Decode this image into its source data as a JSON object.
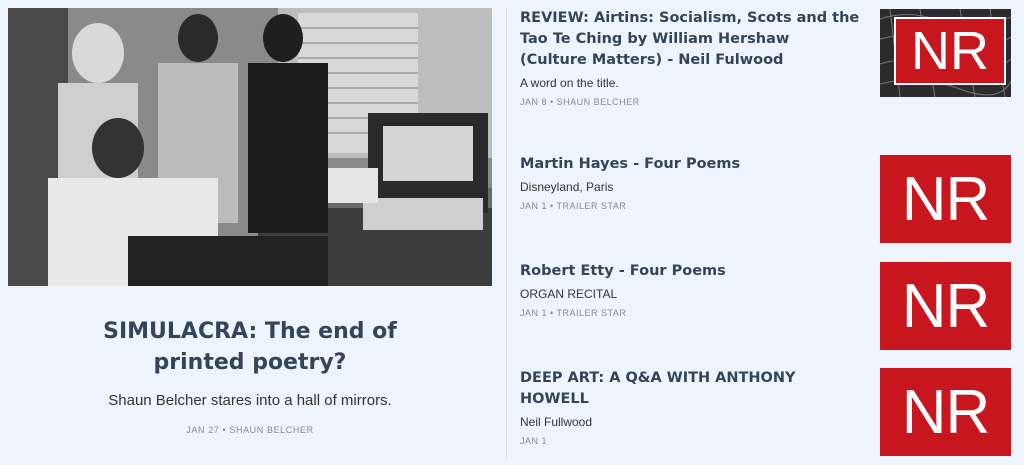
{
  "feature": {
    "title": "SIMULACRA: The end of printed poetry?",
    "subtitle": "Shaun Belcher stares into a hall of mirrors.",
    "meta": "JAN 27 • SHAUN BELCHER",
    "image_icon": "photo-people-at-computer"
  },
  "articles": [
    {
      "title": "REVIEW: Airtins: Socialism, Scots and the Tao Te Ching by William Hershaw (Culture Matters) - Neil Fulwood",
      "subtitle": "A word on the title.",
      "meta": "JAN 8 • SHAUN BELCHER",
      "thumb_text": "NR"
    },
    {
      "title": "Martin Hayes - Four Poems",
      "subtitle": "Disneyland, Paris",
      "meta": "JAN 1 • TRAILER STAR",
      "thumb_text": "NR"
    },
    {
      "title": "Robert Etty - Four Poems",
      "subtitle": "ORGAN RECITAL",
      "meta": "JAN 1 • TRAILER STAR",
      "thumb_text": "NR"
    },
    {
      "title": "DEEP ART: A Q&A WITH ANTHONY HOWELL",
      "subtitle": "Neil Fullwood",
      "meta": "JAN 1",
      "thumb_text": "NR"
    }
  ],
  "colors": {
    "background": "#eef4fb",
    "title": "#34445a",
    "brand_red": "#c8161f"
  }
}
